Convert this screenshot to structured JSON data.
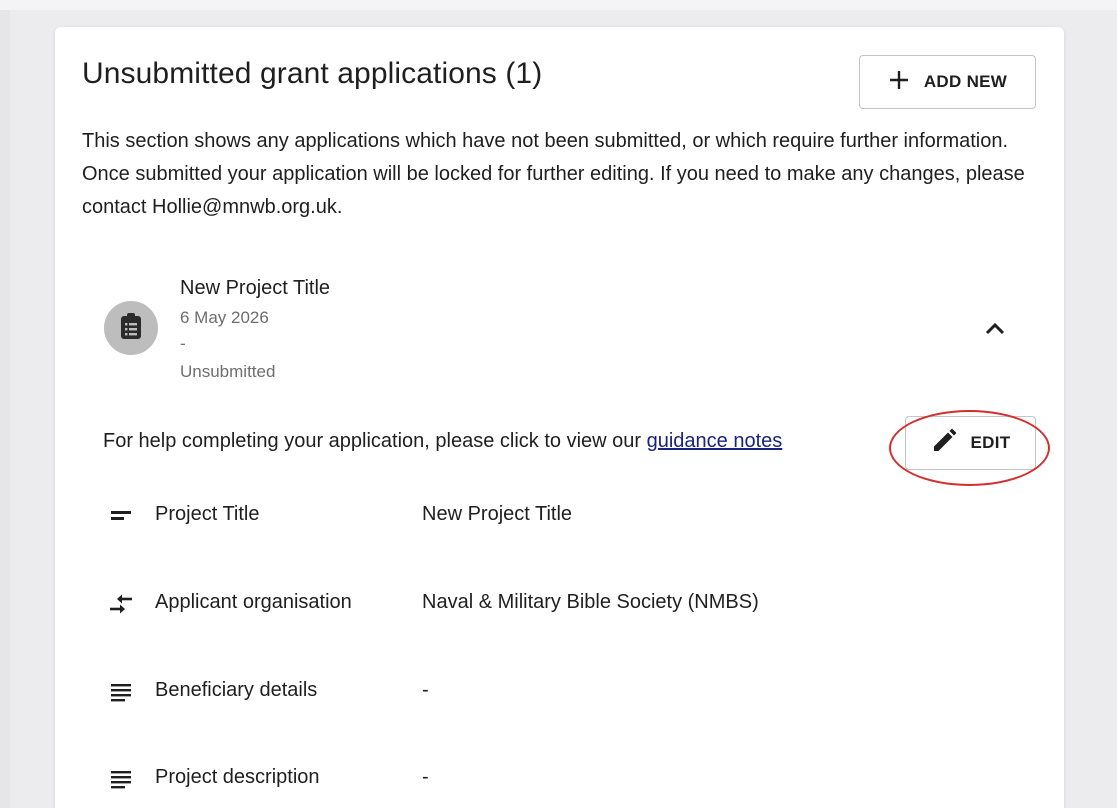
{
  "section": {
    "title": "Unsubmitted grant applications (1)",
    "add_new_label": "ADD NEW",
    "intro": "This section shows any applications which have not been submitted, or which require further information. Once submitted your application will be locked for further editing. If you need to make any changes, please contact Hollie@mnwb.org.uk."
  },
  "application": {
    "title": "New Project Title",
    "date": "6 May 2026",
    "separator": "-",
    "status": "Unsubmitted",
    "avatar_icon": "clipboard-list-icon",
    "collapse_icon": "chevron-up-icon"
  },
  "help": {
    "text": "For help completing your application, please click to view our ",
    "link_text": "guidance notes",
    "edit_label": "EDIT"
  },
  "fields": [
    {
      "icon": "short-text-icon",
      "label": "Project Title",
      "value": "New Project Title"
    },
    {
      "icon": "compare-arrows-icon",
      "label": "Applicant organisation",
      "value": "Naval & Military Bible Society (NMBS)"
    },
    {
      "icon": "notes-icon",
      "label": "Beneficiary details",
      "value": "-"
    },
    {
      "icon": "notes-icon",
      "label": "Project description",
      "value": "-"
    }
  ],
  "colors": {
    "link": "#1a237e",
    "highlight": "#d32f2f",
    "avatar_bg": "#bdbdbd"
  }
}
